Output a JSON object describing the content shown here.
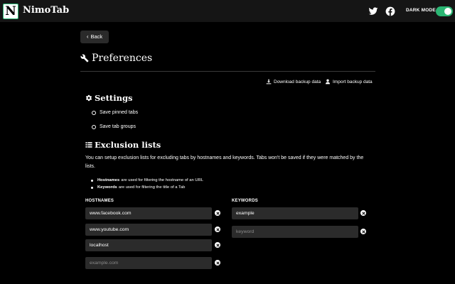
{
  "header": {
    "logo_letter": "N",
    "brand": "NimoTab",
    "dark_mode_label": "DARK MODE",
    "dark_mode_on": true,
    "accent_color": "#2bb673",
    "social": [
      "twitter-icon",
      "facebook-icon"
    ]
  },
  "nav": {
    "back_label": "Back"
  },
  "page": {
    "title": "Preferences",
    "title_icon": "wrench-icon"
  },
  "backup": {
    "download_label": "Download backup data",
    "import_label": "Import backup data"
  },
  "settings": {
    "heading": "Settings",
    "options": [
      {
        "label": "Save pinned tabs",
        "checked": false
      },
      {
        "label": "Save tab groups",
        "checked": false
      }
    ]
  },
  "exclusion": {
    "heading": "Exclusion lists",
    "description": "You can setup exclusion lists for excluding tabs by hostnames and keywords. Tabs won't be saved if they were matched by the lists.",
    "bullets": [
      {
        "term": "Hostnames",
        "text": "are used for filtering the hostname of an URL"
      },
      {
        "term": "Keywords",
        "text": "are used for filtering the title of a Tab"
      }
    ],
    "hostnames": {
      "heading": "HOSTNAMES",
      "values": [
        "www.facebook.com",
        "www.youtube.com",
        "localhost"
      ],
      "placeholder": "example.com"
    },
    "keywords": {
      "heading": "KEYWORDS",
      "values": [
        "example"
      ],
      "placeholder": "keyword"
    }
  }
}
